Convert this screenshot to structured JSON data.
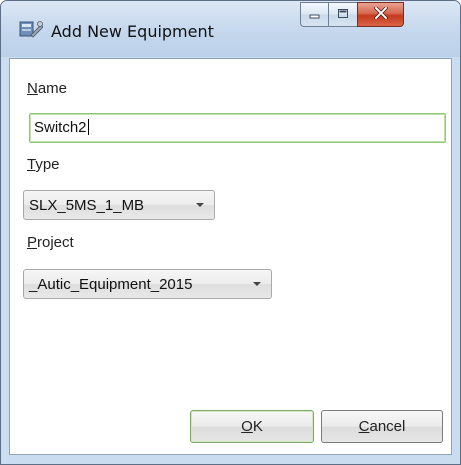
{
  "window": {
    "title": "Add New Equipment",
    "icon": "equipment-app-icon",
    "caption_buttons": [
      "minimize",
      "maximize",
      "close"
    ]
  },
  "form": {
    "name": {
      "label_mnemonic": "N",
      "label_rest": "ame",
      "value": "Switch2"
    },
    "type": {
      "label_mnemonic": "T",
      "label_rest": "ype",
      "selected": "SLX_5MS_1_MB"
    },
    "project": {
      "label_mnemonic": "P",
      "label_rest": "roject",
      "selected": "_Autic_Equipment_2015"
    }
  },
  "buttons": {
    "ok": {
      "mnemonic": "O",
      "rest": "K"
    },
    "cancel": {
      "mnemonic": "C",
      "rest": "ancel"
    }
  },
  "colors": {
    "title_bar": "#c3d6ec",
    "focus_border": "#93c479",
    "close_button": "#c4391b"
  }
}
